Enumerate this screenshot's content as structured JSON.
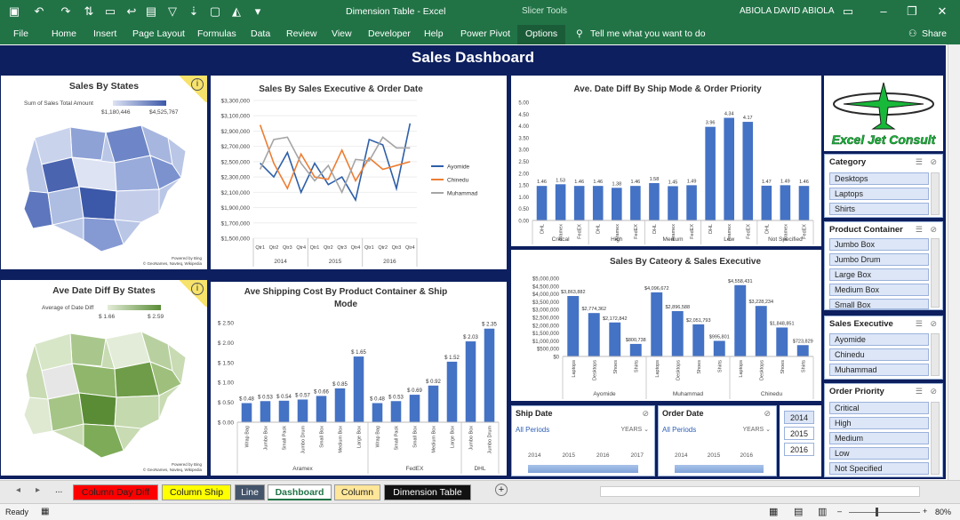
{
  "window": {
    "title": "Dimension Table  -  Excel",
    "context_tab": "Slicer Tools",
    "user": "ABIOLA DAVID ABIOLA"
  },
  "ribbon": {
    "tabs": [
      "File",
      "Home",
      "Insert",
      "Page Layout",
      "Formulas",
      "Data",
      "Review",
      "View",
      "Developer",
      "Help",
      "Power Pivot",
      "Options"
    ],
    "tell_me": "Tell me what you want to do",
    "share": "Share"
  },
  "dashboard": {
    "title": "Sales Dashboard"
  },
  "map_states": {
    "title": "Sales By States",
    "legend_label": "Sum of Sales Total Amount",
    "min": "$1,180,446",
    "max": "$4,525,767",
    "credit1": "Powered by Bing",
    "credit2": "© GeoNames, Navteq, Wikipedia"
  },
  "map_datediff": {
    "title": "Ave Date Diff By States",
    "legend_label": "Average of Date Diff",
    "min": "$ 1.66",
    "max": "$ 2.59",
    "credit1": "Powered by Bing",
    "credit2": "© GeoNames, Navteq, Wikipedia"
  },
  "logo": {
    "text": "Excel Jet Consult"
  },
  "chart_data": [
    {
      "type": "line",
      "title": "Sales By Sales Executive & Order Date",
      "categories": [
        "Qtr1",
        "Qtr2",
        "Qtr3",
        "Qtr4",
        "Qtr1",
        "Qtr2",
        "Qtr3",
        "Qtr4",
        "Qtr1",
        "Qtr2",
        "Qtr3",
        "Qtr4"
      ],
      "groups": [
        "2014",
        "2015",
        "2016"
      ],
      "yticks": [
        "$3,300,000",
        "$3,100,000",
        "$2,900,000",
        "$2,700,000",
        "$2,500,000",
        "$2,300,000",
        "$2,100,000",
        "$1,900,000",
        "$1,700,000",
        "$1,500,000"
      ],
      "ylim": [
        1500000,
        3300000
      ],
      "series": [
        {
          "name": "Ayomide",
          "color": "#2e5fa8",
          "values": [
            2480000,
            2300000,
            2620000,
            2100000,
            2480000,
            2200000,
            2300000,
            2000000,
            2790000,
            2720000,
            2150000,
            3000000
          ]
        },
        {
          "name": "Chinedu",
          "color": "#ed7d31",
          "values": [
            2980000,
            2480000,
            2150000,
            2600000,
            2300000,
            2270000,
            2650000,
            2250000,
            2550000,
            2400000,
            2450000,
            2500000
          ]
        },
        {
          "name": "Muhammad",
          "color": "#a5a5a5",
          "values": [
            2400000,
            2790000,
            2820000,
            2480000,
            2250000,
            2450000,
            2100000,
            2530000,
            2510000,
            2820000,
            2680000,
            2680000
          ]
        }
      ]
    },
    {
      "type": "bar",
      "title": "Ave. Date Diff By Ship Mode &  Order Priority",
      "yticks": [
        "5.00",
        "4.50",
        "4.00",
        "3.50",
        "3.00",
        "2.50",
        "2.00",
        "1.50",
        "1.00",
        "0.50",
        "0.00"
      ],
      "ylim": [
        0,
        5
      ],
      "color": "#4472c4",
      "groups": [
        {
          "name": "Critical",
          "categories": [
            "DHL",
            "Aramex",
            "FedEX"
          ],
          "values": [
            1.46,
            1.53,
            1.46
          ],
          "labels": [
            "1.46",
            "1.53",
            "1.46"
          ]
        },
        {
          "name": "High",
          "categories": [
            "DHL",
            "Aramex",
            "FedEX"
          ],
          "values": [
            1.46,
            1.38,
            1.46
          ],
          "labels": [
            "1.46",
            "1.38",
            "1.46"
          ]
        },
        {
          "name": "Medium",
          "categories": [
            "DHL",
            "Aramex",
            "FedEX"
          ],
          "values": [
            1.58,
            1.45,
            1.49
          ],
          "labels": [
            "1.58",
            "1.45",
            "1.49"
          ]
        },
        {
          "name": "Low",
          "categories": [
            "DHL",
            "Aramex",
            "FedEX"
          ],
          "values": [
            3.96,
            4.34,
            4.17
          ],
          "labels": [
            "3.96",
            "4.34",
            "4.17"
          ]
        },
        {
          "name": "Not Specified",
          "categories": [
            "DHL",
            "Aramex",
            "FedEX"
          ],
          "values": [
            1.47,
            1.49,
            1.46
          ],
          "labels": [
            "1.47",
            "1.49",
            "1.46"
          ]
        }
      ]
    },
    {
      "type": "bar",
      "title": "Ave Shipping Cost By  Product Container & Ship Mode",
      "yticks": [
        "$ 2.50",
        "$ 2.00",
        "$ 1.50",
        "$ 1.00",
        "$ 0.50",
        "$ 0.00"
      ],
      "ylim": [
        0,
        2.5
      ],
      "color": "#4472c4",
      "groups": [
        {
          "name": "Aramex",
          "categories": [
            "Wrap Bag",
            "Jumbo Box",
            "Small Pack",
            "Jumbo Drum",
            "Small Box",
            "Medium Box",
            "Large Box"
          ],
          "values": [
            0.48,
            0.53,
            0.54,
            0.57,
            0.66,
            0.85,
            1.65
          ],
          "labels": [
            "$ 0.48",
            "$ 0.53",
            "$ 0.54",
            "$ 0.57",
            "$ 0.66",
            "$ 0.85",
            "$ 1.65"
          ]
        },
        {
          "name": "FedEX",
          "categories": [
            "Wrap Bag",
            "Small Pack",
            "Small Box",
            "Medium Box",
            "Large Box"
          ],
          "values": [
            0.48,
            0.53,
            0.69,
            0.92,
            1.52
          ],
          "labels": [
            "$ 0.48",
            "$ 0.53",
            "$ 0.69",
            "$ 0.92",
            "$ 1.52"
          ]
        },
        {
          "name": "DHL",
          "categories": [
            "Jumbo Box",
            "Jumbo Drum"
          ],
          "values": [
            2.03,
            2.35
          ],
          "labels": [
            "$ 2.03",
            "$ 2.35"
          ]
        }
      ]
    },
    {
      "type": "bar",
      "title": "Sales By Cateory & Sales Executive",
      "yticks": [
        "$5,000,000",
        "$4,500,000",
        "$4,000,000",
        "$3,500,000",
        "$3,000,000",
        "$2,500,000",
        "$2,000,000",
        "$1,500,000",
        "$1,000,000",
        "$500,000",
        "$0"
      ],
      "ylim": [
        0,
        5000000
      ],
      "color": "#4472c4",
      "groups": [
        {
          "name": "Ayomide",
          "categories": [
            "Laptops",
            "Desktops",
            "Shoes",
            "Shirts"
          ],
          "values": [
            3863882,
            2774362,
            2172842,
            800738
          ],
          "labels": [
            "$3,863,882",
            "$2,774,362",
            "$2,172,842",
            "$800,738"
          ]
        },
        {
          "name": "Muhammad",
          "categories": [
            "Laptops",
            "Desktops",
            "Shoes",
            "Shirts"
          ],
          "values": [
            4096672,
            2896588,
            2051793,
            995801
          ],
          "labels": [
            "$4,096,672",
            "$2,896,588",
            "$2,051,793",
            "$995,801"
          ]
        },
        {
          "name": "Chinedu",
          "categories": [
            "Laptops",
            "Desktops",
            "Shoes",
            "Shirts"
          ],
          "values": [
            4558431,
            3228234,
            1848851,
            723829
          ],
          "labels": [
            "$4,558,431",
            "$3,228,234",
            "$1,848,851",
            "$723,829"
          ]
        }
      ]
    }
  ],
  "slicers": {
    "category": {
      "title": "Category",
      "items": [
        "Desktops",
        "Laptops",
        "Shirts"
      ]
    },
    "container": {
      "title": "Product Container",
      "items": [
        "Jumbo Box",
        "Jumbo Drum",
        "Large Box",
        "Medium Box",
        "Small Box"
      ]
    },
    "executive": {
      "title": "Sales Executive",
      "items": [
        "Ayomide",
        "Chinedu",
        "Muhammad"
      ]
    },
    "priority": {
      "title": "Order Priority",
      "items": [
        "Critical",
        "High",
        "Medium",
        "Low",
        "Not Specified"
      ]
    }
  },
  "timelines": {
    "ship": {
      "title": "Ship Date",
      "periods": "All Periods",
      "unit": "YEARS",
      "years": [
        "2014",
        "2015",
        "2016",
        "2017"
      ]
    },
    "order": {
      "title": "Order Date",
      "periods": "All Periods",
      "unit": "YEARS",
      "years": [
        "2014",
        "2015",
        "2016"
      ]
    }
  },
  "year_buttons": [
    "2014",
    "2015",
    "2016"
  ],
  "sheet_tabs": [
    {
      "label": "Column Day Diff",
      "bg": "#ff0000",
      "fg": "#222"
    },
    {
      "label": "Column Ship",
      "bg": "#ffff00",
      "fg": "#222"
    },
    {
      "label": "Line",
      "bg": "#44546a",
      "fg": "#fff"
    },
    {
      "label": "Dashboard",
      "bg": "#ffffff",
      "fg": "#217346"
    },
    {
      "label": "Column",
      "bg": "#ffe699",
      "fg": "#222"
    },
    {
      "label": "Dimension Table",
      "bg": "#111111",
      "fg": "#fff"
    }
  ],
  "status": {
    "ready": "Ready",
    "zoom": "80%",
    "ellipsis": "..."
  }
}
